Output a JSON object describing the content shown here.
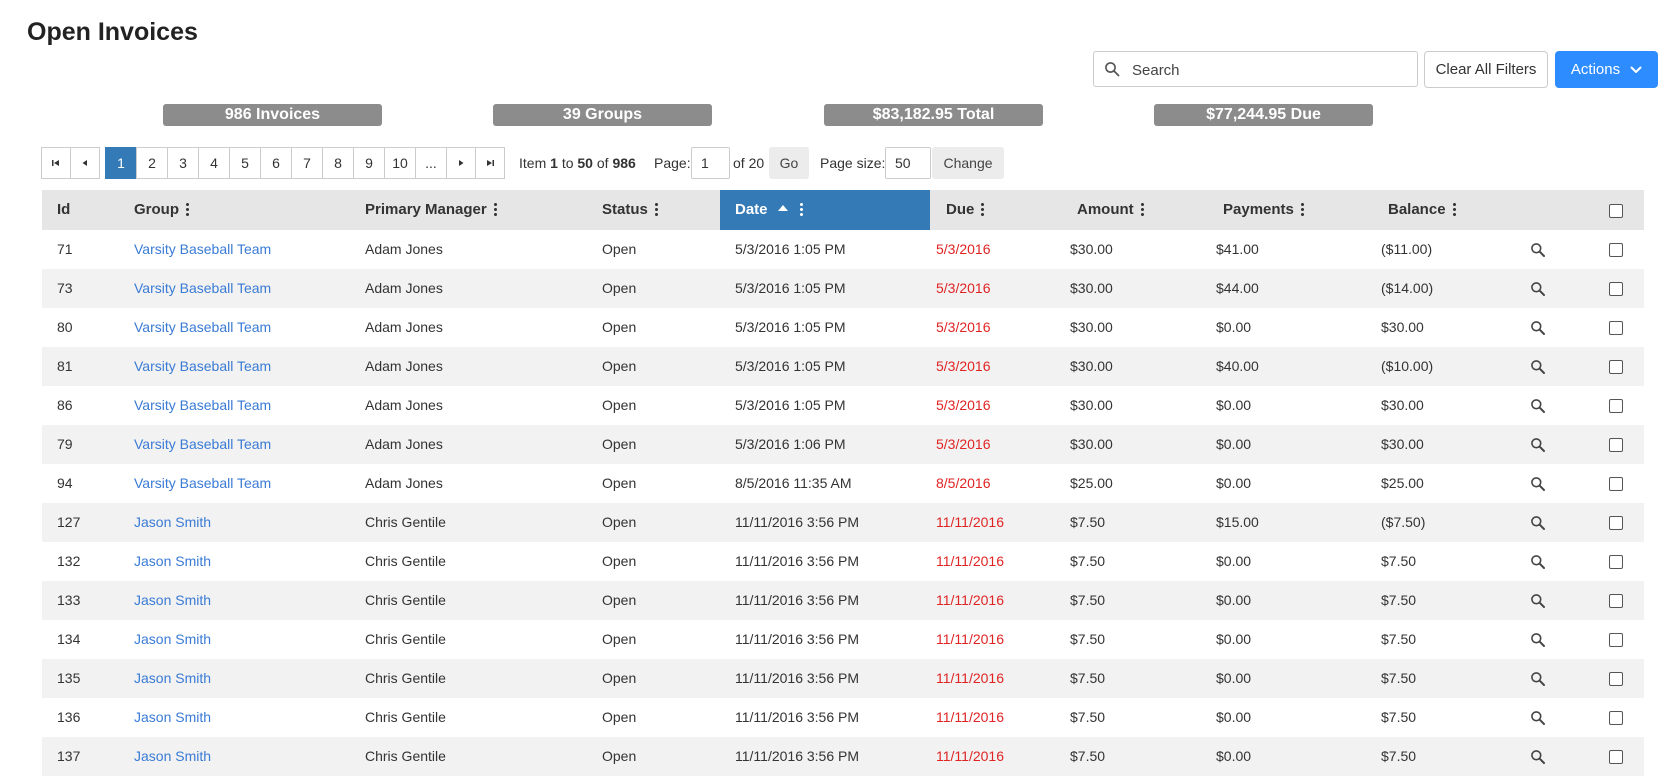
{
  "page": {
    "title": "Open Invoices"
  },
  "toolbar": {
    "search_placeholder": "Search",
    "clear_filters_label": "Clear All Filters",
    "actions_label": "Actions",
    "accent_color": "#2d8cff"
  },
  "summary": {
    "invoices": "986 Invoices",
    "groups": "39 Groups",
    "total": "$83,182.95 Total",
    "due": "$77,244.95 Due"
  },
  "pager": {
    "pages": [
      "1",
      "2",
      "3",
      "4",
      "5",
      "6",
      "7",
      "8",
      "9",
      "10",
      "..."
    ],
    "active_page": "1",
    "item_prefix": "Item",
    "item_from": "1",
    "item_to_word": "to",
    "item_to": "50",
    "item_of_word": "of",
    "item_total": "986",
    "page_label": "Page:",
    "page_value": "1",
    "page_of": "of 20",
    "go_label": "Go",
    "page_size_label": "Page size:",
    "page_size_value": "50",
    "change_label": "Change"
  },
  "table": {
    "columns": {
      "id": "Id",
      "group": "Group",
      "manager": "Primary Manager",
      "status": "Status",
      "date": "Date",
      "due": "Due",
      "amount": "Amount",
      "payments": "Payments",
      "balance": "Balance"
    },
    "sorted_column": "date",
    "sort_direction": "ascending",
    "rows": [
      {
        "id": "71",
        "group": "Varsity Baseball Team",
        "manager": "Adam Jones",
        "status": "Open",
        "date": "5/3/2016 1:05 PM",
        "due": "5/3/2016",
        "amount": "$30.00",
        "payments": "$41.00",
        "balance": "($11.00)"
      },
      {
        "id": "73",
        "group": "Varsity Baseball Team",
        "manager": "Adam Jones",
        "status": "Open",
        "date": "5/3/2016 1:05 PM",
        "due": "5/3/2016",
        "amount": "$30.00",
        "payments": "$44.00",
        "balance": "($14.00)"
      },
      {
        "id": "80",
        "group": "Varsity Baseball Team",
        "manager": "Adam Jones",
        "status": "Open",
        "date": "5/3/2016 1:05 PM",
        "due": "5/3/2016",
        "amount": "$30.00",
        "payments": "$0.00",
        "balance": "$30.00"
      },
      {
        "id": "81",
        "group": "Varsity Baseball Team",
        "manager": "Adam Jones",
        "status": "Open",
        "date": "5/3/2016 1:05 PM",
        "due": "5/3/2016",
        "amount": "$30.00",
        "payments": "$40.00",
        "balance": "($10.00)"
      },
      {
        "id": "86",
        "group": "Varsity Baseball Team",
        "manager": "Adam Jones",
        "status": "Open",
        "date": "5/3/2016 1:05 PM",
        "due": "5/3/2016",
        "amount": "$30.00",
        "payments": "$0.00",
        "balance": "$30.00"
      },
      {
        "id": "79",
        "group": "Varsity Baseball Team",
        "manager": "Adam Jones",
        "status": "Open",
        "date": "5/3/2016 1:06 PM",
        "due": "5/3/2016",
        "amount": "$30.00",
        "payments": "$0.00",
        "balance": "$30.00"
      },
      {
        "id": "94",
        "group": "Varsity Baseball Team",
        "manager": "Adam Jones",
        "status": "Open",
        "date": "8/5/2016 11:35 AM",
        "due": "8/5/2016",
        "amount": "$25.00",
        "payments": "$0.00",
        "balance": "$25.00"
      },
      {
        "id": "127",
        "group": "Jason Smith",
        "manager": "Chris Gentile",
        "status": "Open",
        "date": "11/11/2016 3:56 PM",
        "due": "11/11/2016",
        "amount": "$7.50",
        "payments": "$15.00",
        "balance": "($7.50)"
      },
      {
        "id": "132",
        "group": "Jason Smith",
        "manager": "Chris Gentile",
        "status": "Open",
        "date": "11/11/2016 3:56 PM",
        "due": "11/11/2016",
        "amount": "$7.50",
        "payments": "$0.00",
        "balance": "$7.50"
      },
      {
        "id": "133",
        "group": "Jason Smith",
        "manager": "Chris Gentile",
        "status": "Open",
        "date": "11/11/2016 3:56 PM",
        "due": "11/11/2016",
        "amount": "$7.50",
        "payments": "$0.00",
        "balance": "$7.50"
      },
      {
        "id": "134",
        "group": "Jason Smith",
        "manager": "Chris Gentile",
        "status": "Open",
        "date": "11/11/2016 3:56 PM",
        "due": "11/11/2016",
        "amount": "$7.50",
        "payments": "$0.00",
        "balance": "$7.50"
      },
      {
        "id": "135",
        "group": "Jason Smith",
        "manager": "Chris Gentile",
        "status": "Open",
        "date": "11/11/2016 3:56 PM",
        "due": "11/11/2016",
        "amount": "$7.50",
        "payments": "$0.00",
        "balance": "$7.50"
      },
      {
        "id": "136",
        "group": "Jason Smith",
        "manager": "Chris Gentile",
        "status": "Open",
        "date": "11/11/2016 3:56 PM",
        "due": "11/11/2016",
        "amount": "$7.50",
        "payments": "$0.00",
        "balance": "$7.50"
      },
      {
        "id": "137",
        "group": "Jason Smith",
        "manager": "Chris Gentile",
        "status": "Open",
        "date": "11/11/2016 3:56 PM",
        "due": "11/11/2016",
        "amount": "$7.50",
        "payments": "$0.00",
        "balance": "$7.50"
      }
    ]
  },
  "colors": {
    "link": "#3a7bd5",
    "due_overdue": "#e02424",
    "sorted_header": "#337ab7",
    "badge": "#8c8c8c"
  },
  "icons": {
    "search": "search-icon",
    "row_view": "magnifier-icon",
    "actions_caret": "chevron-down-icon"
  }
}
